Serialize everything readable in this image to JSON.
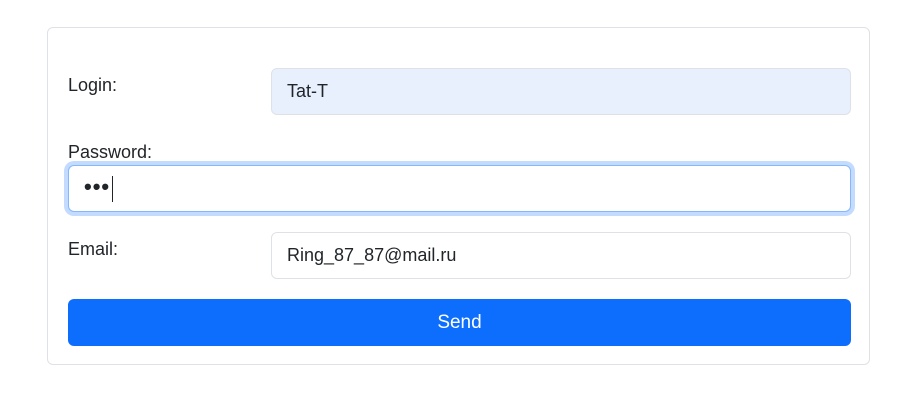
{
  "form": {
    "login": {
      "label": "Login:",
      "value": "Tat-T"
    },
    "password": {
      "label": "Password:",
      "masked_value": "•••"
    },
    "email": {
      "label": "Email:",
      "value": "Ring_87_87@mail.ru"
    },
    "send_label": "Send"
  },
  "colors": {
    "primary": "#0d6efd",
    "autofill_bg": "#e8f0fe",
    "focus_border": "#86b7fe",
    "border": "#dee2e6"
  }
}
